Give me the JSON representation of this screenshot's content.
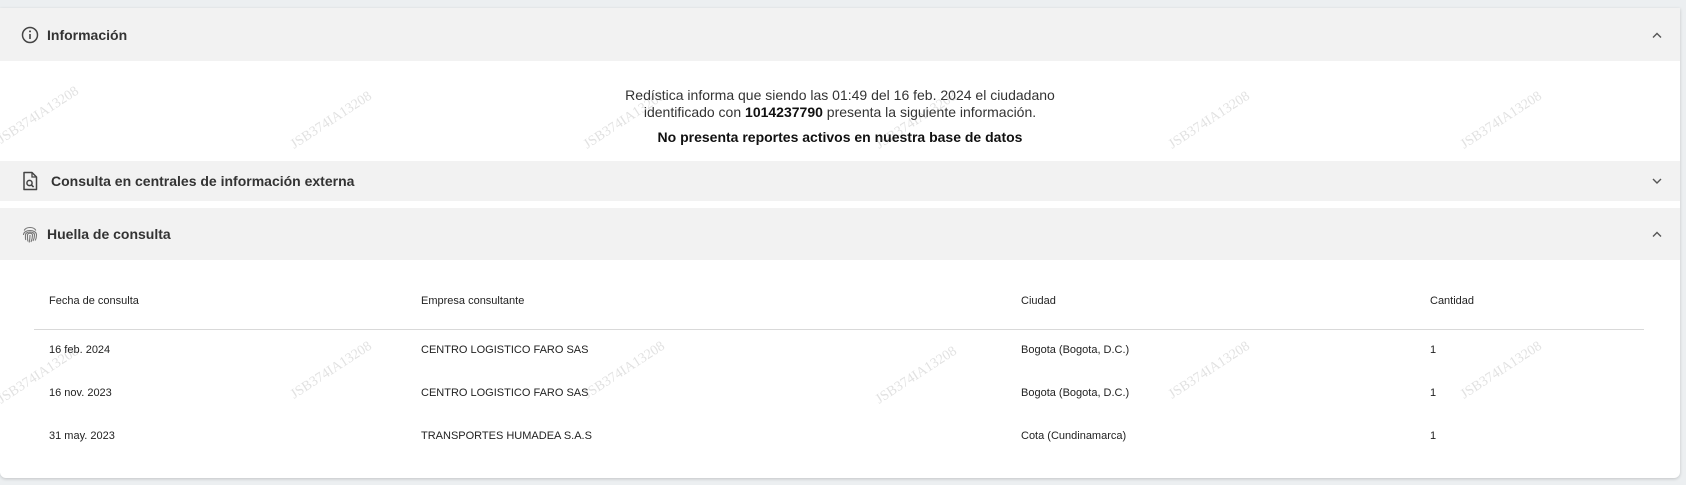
{
  "sections": {
    "informacion": {
      "title": "Información",
      "icon": "info-circle-icon",
      "expanded": true,
      "line1": "Redística informa que siendo las 01:49 del 16 feb. 2024 el ciudadano",
      "line2_prefix": "identificado con ",
      "line2_id": "1014237790",
      "line2_suffix": " presenta la siguiente información.",
      "line3": "No presenta reportes activos en nuestra base de datos"
    },
    "consulta_externa": {
      "title": "Consulta en centrales de información externa",
      "icon": "document-search-icon",
      "expanded": false
    },
    "huella": {
      "title": "Huella de consulta",
      "icon": "fingerprint-icon",
      "expanded": true,
      "table": {
        "columns": [
          "Fecha de consulta",
          "Empresa consultante",
          "Ciudad",
          "Cantidad"
        ],
        "rows": [
          [
            "16 feb. 2024",
            "CENTRO LOGISTICO FARO SAS",
            "Bogota (Bogota, D.C.)",
            "1"
          ],
          [
            "16 nov. 2023",
            "CENTRO LOGISTICO FARO SAS",
            "Bogota (Bogota, D.C.)",
            "1"
          ],
          [
            "31 may. 2023",
            "TRANSPORTES HUMADEA S.A.S",
            "Cota (Cundinamarca)",
            "1"
          ]
        ]
      }
    }
  },
  "watermark": "JSB374IA13208"
}
